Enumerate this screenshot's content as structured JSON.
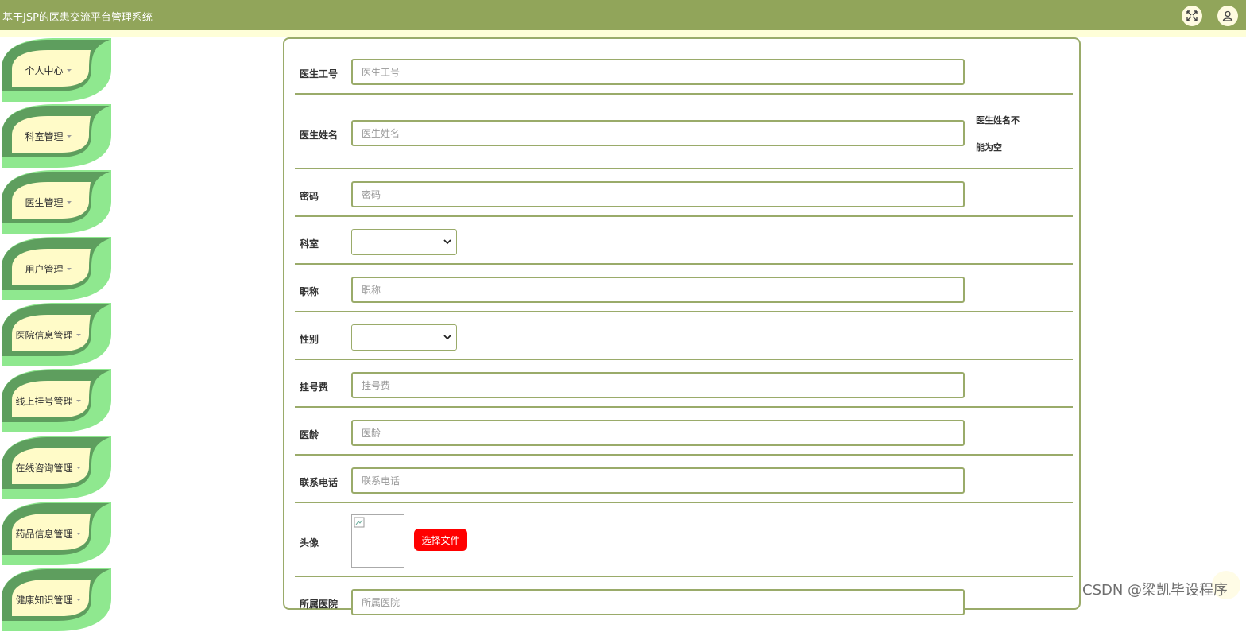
{
  "app": {
    "title": "基于JSP的医患交流平台管理系统"
  },
  "header": {
    "fullscreen_icon": "expand-arrows-icon",
    "user_icon": "user-icon"
  },
  "sidebar": {
    "items": [
      {
        "label": "个人中心"
      },
      {
        "label": "科室管理"
      },
      {
        "label": "医生管理"
      },
      {
        "label": "用户管理"
      },
      {
        "label": "医院信息管理"
      },
      {
        "label": "线上挂号管理"
      },
      {
        "label": "在线咨询管理"
      },
      {
        "label": "药品信息管理"
      },
      {
        "label": "健康知识管理"
      }
    ]
  },
  "form": {
    "doctor_id": {
      "label": "医生工号",
      "placeholder": "医生工号",
      "value": ""
    },
    "doctor_name": {
      "label": "医生姓名",
      "placeholder": "医生姓名",
      "value": "",
      "error_line1": "医生姓名不",
      "error_line2": "能为空"
    },
    "password": {
      "label": "密码",
      "placeholder": "密码",
      "value": ""
    },
    "department": {
      "label": "科室",
      "selected": ""
    },
    "title": {
      "label": "职称",
      "placeholder": "职称",
      "value": ""
    },
    "gender": {
      "label": "性别",
      "selected": ""
    },
    "fee": {
      "label": "挂号费",
      "placeholder": "挂号费",
      "value": ""
    },
    "seniority": {
      "label": "医龄",
      "placeholder": "医龄",
      "value": ""
    },
    "phone": {
      "label": "联系电话",
      "placeholder": "联系电话",
      "value": ""
    },
    "avatar": {
      "label": "头像",
      "button_label": "选择文件"
    },
    "hospital": {
      "label": "所属医院",
      "placeholder": "所属医院",
      "value": ""
    }
  },
  "watermark": {
    "text": "CSDN @梁凯毕设程序"
  },
  "colors": {
    "header_bg": "#91a55a",
    "accent_border": "#9aab6a",
    "leaf_dark": "#5e9e5e",
    "leaf_light": "#8fe88f",
    "leaf_center": "#fffbc8",
    "file_button": "#ff0000"
  }
}
